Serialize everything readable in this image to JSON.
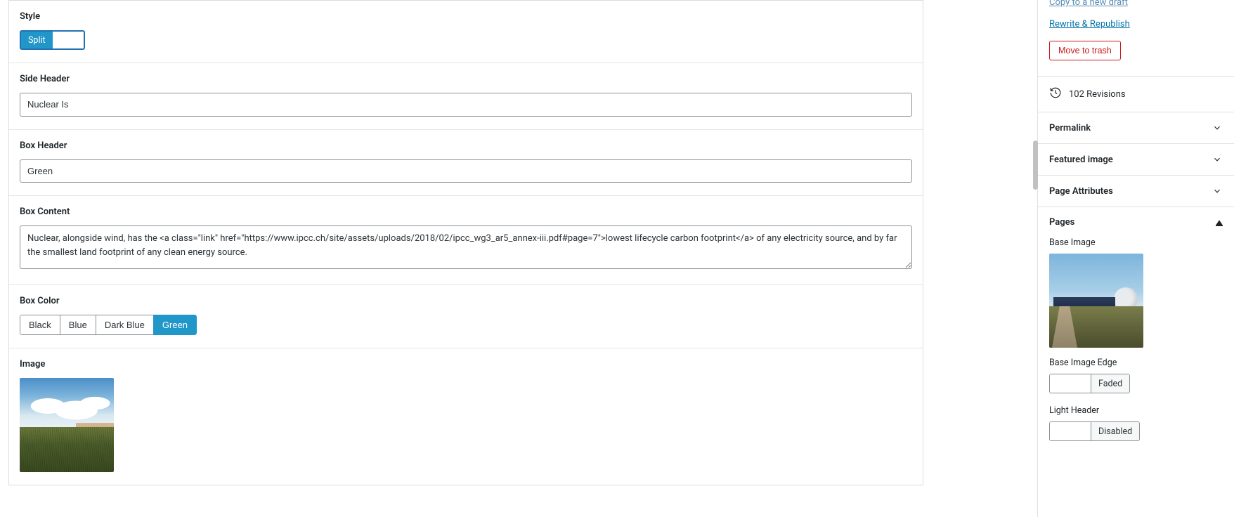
{
  "style": {
    "label": "Style",
    "toggle_value": "Split"
  },
  "side_header": {
    "label": "Side Header",
    "value": "Nuclear Is"
  },
  "box_header": {
    "label": "Box Header",
    "value": "Green"
  },
  "box_content": {
    "label": "Box Content",
    "value": "Nuclear, alongside wind, has the <a class=\"link\" href=\"https://www.ipcc.ch/site/assets/uploads/2018/02/ipcc_wg3_ar5_annex-iii.pdf#page=7\">lowest lifecycle carbon footprint</a> of any electricity source, and by far the smallest land footprint of any clean energy source."
  },
  "box_color": {
    "label": "Box Color",
    "options": [
      "Black",
      "Blue",
      "Dark Blue",
      "Green"
    ],
    "selected": "Green"
  },
  "image": {
    "label": "Image"
  },
  "sidebar": {
    "copy_link": "Copy to a new draft",
    "rewrite_link": "Rewrite & Republish",
    "trash": "Move to trash",
    "revisions": "102 Revisions",
    "permalink": "Permalink",
    "featured_image": "Featured image",
    "page_attributes": "Page Attributes",
    "pages": "Pages",
    "base_image_label": "Base Image",
    "base_image_edge_label": "Base Image Edge",
    "base_image_edge_value": "Faded",
    "light_header_label": "Light Header",
    "light_header_value": "Disabled"
  }
}
